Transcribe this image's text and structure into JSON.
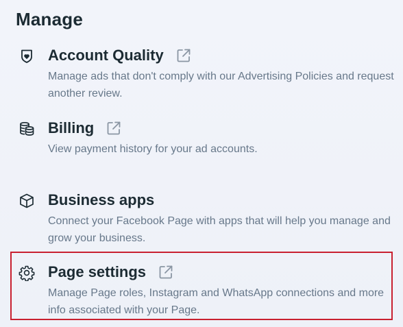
{
  "section": {
    "title": "Manage"
  },
  "items": [
    {
      "title": "Account Quality",
      "description": "Manage ads that don't comply with our Advertising Policies and request another review.",
      "icon": "shield-icon",
      "has_external_link": true
    },
    {
      "title": "Billing",
      "description": "View payment history for your ad accounts.",
      "icon": "coins-icon",
      "has_external_link": true
    },
    {
      "title": "Business apps",
      "description": "Connect your Facebook Page with apps that will help you manage and grow your business.",
      "icon": "cube-icon",
      "has_external_link": false
    },
    {
      "title": "Page settings",
      "description": "Manage Page roles, Instagram and WhatsApp connections and more info associated with your Page.",
      "icon": "gear-icon",
      "has_external_link": true,
      "highlighted": true
    }
  ],
  "colors": {
    "title": "#1c2b33",
    "description": "#67788a",
    "highlight_border": "#c8202f",
    "background": "#f1f3f9"
  }
}
